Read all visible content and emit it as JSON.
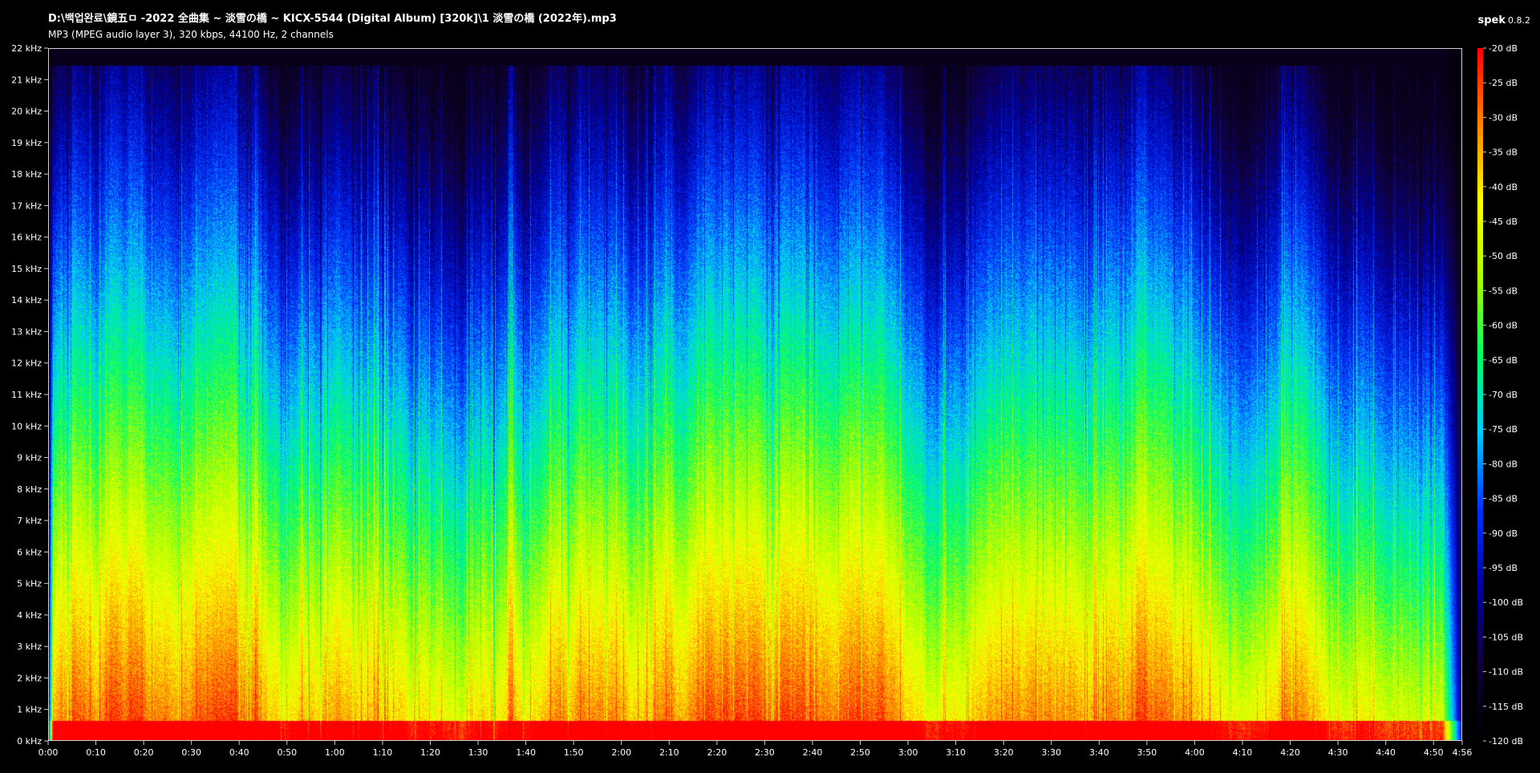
{
  "header": {
    "title": "D:\\백업완료\\鏡五ㅁ -2022 全曲集 ~ 淡雪の橋 ~ KICX-5544 (Digital Album) [320k]\\1 淡雪の橋 (2022年).mp3",
    "info": "MP3 (MPEG audio layer 3), 320 kbps, 44100 Hz, 2 channels",
    "app_name": "spek",
    "app_version": "0.8.2"
  },
  "colors": {
    "background": "#000000",
    "frame": "#cfcfcf",
    "palette": [
      "#000000",
      "#12003a",
      "#0000a0",
      "#0033ff",
      "#00ccff",
      "#00ff66",
      "#aaff00",
      "#ffff00",
      "#ff8800",
      "#ff0000"
    ]
  },
  "chart_data": {
    "type": "heatmap",
    "x_unit": "time",
    "y_unit": "kHz",
    "xlim": [
      "0:00",
      "4:56"
    ],
    "ylim": [
      0,
      22
    ],
    "zlim": [
      -120,
      -20
    ],
    "x_ticks": [
      "0:00",
      "0:10",
      "0:20",
      "0:30",
      "0:40",
      "0:50",
      "1:00",
      "1:10",
      "1:20",
      "1:30",
      "1:40",
      "1:50",
      "2:00",
      "2:10",
      "2:20",
      "2:30",
      "2:40",
      "2:50",
      "3:00",
      "3:10",
      "3:20",
      "3:30",
      "3:40",
      "3:50",
      "4:00",
      "4:10",
      "4:20",
      "4:30",
      "4:40",
      "4:50",
      "4:56"
    ],
    "y_ticks": [
      "0 kHz",
      "1 kHz",
      "2 kHz",
      "3 kHz",
      "4 kHz",
      "5 kHz",
      "6 kHz",
      "7 kHz",
      "8 kHz",
      "9 kHz",
      "10 kHz",
      "11 kHz",
      "12 kHz",
      "13 kHz",
      "14 kHz",
      "15 kHz",
      "16 kHz",
      "17 kHz",
      "18 kHz",
      "19 kHz",
      "20 kHz",
      "21 kHz",
      "22 kHz"
    ],
    "colorbar_ticks": [
      "-20 dB",
      "-25 dB",
      "-30 dB",
      "-35 dB",
      "-40 dB",
      "-45 dB",
      "-50 dB",
      "-55 dB",
      "-60 dB",
      "-65 dB",
      "-70 dB",
      "-75 dB",
      "-80 dB",
      "-85 dB",
      "-90 dB",
      "-95 dB",
      "-100 dB",
      "-105 dB",
      "-110 dB",
      "-115 dB",
      "-120 dB"
    ]
  }
}
